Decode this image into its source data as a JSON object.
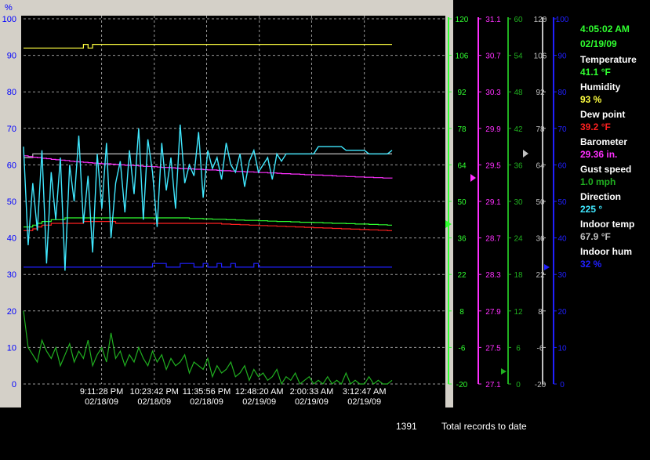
{
  "colors": {
    "background": "#000000",
    "plot_frame": "#d4d0c8",
    "grid": "#9a9a9a",
    "humidity": "#ffff40",
    "wind": "#40e8ff",
    "barometer": "#ff30ff",
    "temperature": "#30ff30",
    "dewpoint": "#ff2020",
    "indoor_hum": "#2020ff",
    "gust": "#20b020",
    "indoor_temp": "#c0c0c0"
  },
  "readouts": {
    "time": "4:05:02 AM",
    "date": "02/19/09",
    "items": [
      {
        "label": "Temperature",
        "value": "41.1 °F",
        "color": "#30ff30"
      },
      {
        "label": "Humidity",
        "value": "93 %",
        "color": "#ffff40"
      },
      {
        "label": "Dew point",
        "value": "39.2 °F",
        "color": "#ff2020"
      },
      {
        "label": "Barometer",
        "value": "29.36 in.",
        "color": "#ff30ff"
      },
      {
        "label": "Gust speed",
        "value": "1.0 mph",
        "color": "#20b020"
      },
      {
        "label": "Direction",
        "value": "225 °",
        "color": "#40e8ff"
      },
      {
        "label": "Indoor temp",
        "value": "67.9 °F",
        "color": "#c0c0c0"
      },
      {
        "label": "Indoor hum",
        "value": "32 %",
        "color": "#2020ff"
      }
    ]
  },
  "status": {
    "record_count": "1391",
    "record_text": "Total records to date"
  },
  "chart_data": {
    "type": "line",
    "left_axis": {
      "title": "%",
      "ticks": [
        "0",
        "10",
        "20",
        "30",
        "40",
        "50",
        "60",
        "70",
        "80",
        "90",
        "100"
      ],
      "range": [
        0,
        100
      ]
    },
    "x_ticks": [
      {
        "time": "9:11:28 PM",
        "date": "02/18/09",
        "pos": 0.148
      },
      {
        "time": "10:23:42 PM",
        "date": "02/18/09",
        "pos": 0.291
      },
      {
        "time": "11:35:56 PM",
        "date": "02/18/09",
        "pos": 0.433
      },
      {
        "time": "12:48:20 AM",
        "date": "02/19/09",
        "pos": 0.576
      },
      {
        "time": "2:00:33 AM",
        "date": "02/19/09",
        "pos": 0.718
      },
      {
        "time": "3:12:47 AM",
        "date": "02/19/09",
        "pos": 0.861
      }
    ],
    "right_axes": [
      {
        "name": "temperature",
        "ticks": [
          "-20",
          "-6",
          "8",
          "22",
          "36",
          "50",
          "64",
          "78",
          "92",
          "106",
          "120"
        ],
        "color": "#30ff30",
        "range": [
          -20,
          120
        ]
      },
      {
        "name": "barometer",
        "ticks": [
          "27.1",
          "27.5",
          "27.9",
          "28.3",
          "28.7",
          "29.1",
          "29.5",
          "29.9",
          "30.3",
          "30.7",
          "31.1"
        ],
        "color": "#ff30ff",
        "range": [
          27.1,
          31.1
        ]
      },
      {
        "name": "wind speed",
        "ticks": [
          "0",
          "6",
          "12",
          "18",
          "24",
          "30",
          "36",
          "42",
          "48",
          "54",
          "60"
        ],
        "color": "#20b020",
        "range": [
          0,
          60
        ]
      },
      {
        "name": "indoor temp",
        "ticks": [
          "-20",
          "-6",
          "8",
          "22",
          "36",
          "50",
          "64",
          "78",
          "92",
          "106",
          "120"
        ],
        "color": "#c0c0c0",
        "range": [
          -20,
          120
        ]
      },
      {
        "name": "indoor humidity",
        "ticks": [
          "0",
          "10",
          "20",
          "30",
          "40",
          "50",
          "60",
          "70",
          "80",
          "90",
          "100"
        ],
        "color": "#2020ff",
        "range": [
          0,
          100
        ]
      }
    ],
    "series": [
      {
        "key": "humidity",
        "color": "#ffff40",
        "values": [
          92,
          92,
          92,
          92,
          92,
          92,
          92,
          92,
          92,
          92,
          92,
          92,
          92,
          93,
          92,
          93,
          93,
          93,
          93,
          93,
          93,
          93,
          93,
          93,
          93,
          93,
          93,
          93,
          93,
          93,
          93,
          93,
          93,
          93,
          93,
          93,
          93,
          93,
          93,
          93,
          93,
          93,
          93,
          93,
          93,
          93,
          93,
          93,
          93,
          93,
          93,
          93,
          93,
          93,
          93,
          93,
          93,
          93,
          93,
          93,
          93,
          93,
          93,
          93,
          93,
          93,
          93,
          93,
          93,
          93,
          93,
          93,
          93,
          93,
          93,
          93,
          93,
          93,
          93,
          93,
          93
        ]
      },
      {
        "key": "indoor_temp",
        "color": "#c0c0c0",
        "values": [
          62,
          62,
          63,
          63,
          63,
          63,
          63,
          63,
          63,
          63,
          63,
          63,
          63,
          63,
          63,
          63,
          63,
          63,
          63,
          63,
          63,
          63,
          63,
          63,
          63,
          63,
          63,
          63,
          63,
          63,
          63,
          63,
          63,
          63,
          63,
          63,
          63,
          63,
          63,
          63,
          63,
          63,
          63,
          63,
          63,
          63,
          63,
          63,
          63,
          63,
          63,
          63,
          63,
          63,
          63,
          63,
          63,
          63,
          63,
          63,
          63,
          63,
          63,
          63,
          63,
          63,
          63,
          63,
          63,
          63,
          63,
          63,
          63,
          63,
          63,
          63,
          63,
          63,
          63,
          63,
          63
        ]
      },
      {
        "key": "barometer",
        "color": "#ff30ff",
        "values": [
          62.5,
          62.3,
          62.1,
          62.0,
          61.8,
          61.7,
          61.5,
          61.4,
          61.3,
          61.2,
          61.0,
          60.9,
          60.8,
          60.7,
          60.6,
          60.5,
          60.4,
          60.3,
          60.3,
          60.2,
          60.1,
          60.0,
          59.9,
          59.9,
          59.8,
          59.7,
          59.6,
          59.6,
          59.5,
          59.4,
          59.3,
          59.3,
          59.2,
          59.1,
          59.0,
          59.0,
          58.9,
          58.8,
          58.8,
          58.7,
          58.6,
          58.6,
          58.5,
          58.4,
          58.4,
          58.3,
          58.2,
          58.2,
          58.1,
          58.1,
          58.0,
          57.9,
          57.9,
          57.8,
          57.8,
          57.7,
          57.6,
          57.6,
          57.5,
          57.5,
          57.4,
          57.3,
          57.3,
          57.2,
          57.2,
          57.1,
          57.1,
          57.0,
          56.9,
          56.9,
          56.8,
          56.8,
          56.7,
          56.7,
          56.6,
          56.6,
          56.5,
          56.5,
          56.4,
          56.4,
          56.3
        ]
      },
      {
        "key": "temperature",
        "color": "#30ff30",
        "values": [
          43,
          43,
          43.5,
          44,
          44.5,
          44.5,
          45,
          45,
          45,
          45.5,
          45.5,
          45.5,
          45.5,
          45.5,
          45.5,
          45.5,
          45.5,
          45.5,
          45.5,
          45.5,
          45.5,
          45.5,
          45.5,
          45.5,
          45.5,
          45.5,
          45.5,
          45.5,
          45.5,
          45.5,
          45.5,
          45.5,
          45.5,
          45.5,
          45.5,
          45.5,
          45.3,
          45.3,
          45.3,
          45.2,
          45.2,
          45.1,
          45.1,
          45.1,
          45,
          45,
          44.9,
          44.9,
          44.8,
          44.8,
          44.8,
          44.7,
          44.7,
          44.6,
          44.6,
          44.5,
          44.5,
          44.5,
          44.4,
          44.4,
          44.3,
          44.3,
          44.3,
          44.2,
          44.2,
          44.1,
          44.1,
          44,
          44,
          44,
          43.9,
          43.9,
          43.8,
          43.8,
          43.8,
          43.7,
          43.7,
          43.6,
          43.6,
          43.5,
          43.5
        ]
      },
      {
        "key": "dewpoint",
        "color": "#ff2020",
        "values": [
          42,
          42,
          42.5,
          43,
          43.5,
          43.5,
          44,
          44,
          44,
          44,
          44,
          44,
          44,
          44.5,
          44.5,
          44.5,
          44.5,
          44.5,
          44.5,
          44.5,
          44,
          44,
          44,
          44,
          44,
          44,
          44,
          44,
          44,
          44,
          44,
          44,
          44,
          44,
          44,
          44,
          44,
          44,
          44,
          44,
          44,
          44,
          44,
          43.8,
          43.8,
          43.7,
          43.7,
          43.6,
          43.6,
          43.5,
          43.5,
          43.4,
          43.4,
          43.3,
          43.3,
          43.2,
          43.2,
          43.1,
          43.1,
          43,
          43,
          42.9,
          42.9,
          42.8,
          42.8,
          42.7,
          42.7,
          42.6,
          42.6,
          42.5,
          42.5,
          42.4,
          42.4,
          42.3,
          42.3,
          42.2,
          42.2,
          42.1,
          42.1,
          42,
          42
        ]
      },
      {
        "key": "indoor_hum",
        "color": "#2020ff",
        "values": [
          32,
          32,
          32,
          32,
          32,
          32,
          32,
          32,
          32,
          32,
          32,
          32,
          32,
          32,
          32,
          32,
          32,
          32,
          32,
          32,
          32,
          32,
          32,
          32,
          32,
          32,
          32,
          32,
          33,
          33,
          33,
          32,
          32,
          32,
          33,
          33,
          33,
          32,
          32,
          33,
          32,
          32,
          33,
          32,
          32,
          33,
          32,
          32,
          32,
          32,
          33,
          32,
          32,
          32,
          32,
          32,
          32,
          32,
          32,
          32,
          32,
          32,
          32,
          32,
          32,
          32,
          32,
          32,
          32,
          32,
          32,
          32,
          32,
          32,
          32,
          32,
          32,
          32,
          32,
          32,
          32
        ]
      },
      {
        "key": "wind_dir",
        "color": "#40e8ff",
        "values": [
          65,
          38,
          55,
          42,
          64,
          33,
          58,
          45,
          62,
          31,
          60,
          50,
          68,
          44,
          57,
          36,
          63,
          48,
          66,
          40,
          55,
          61,
          47,
          64,
          52,
          70,
          45,
          67,
          58,
          43,
          66,
          53,
          62,
          48,
          71,
          55,
          60,
          57,
          69,
          51,
          64,
          59,
          62,
          56,
          66,
          60,
          58,
          63,
          54,
          61,
          64,
          58,
          60,
          62,
          56,
          63,
          61,
          63,
          63,
          63,
          63,
          63,
          63,
          63,
          65,
          65,
          65,
          65,
          65,
          65,
          64,
          64,
          64,
          64,
          64,
          63,
          63,
          63,
          63,
          63,
          64
        ]
      },
      {
        "key": "gust",
        "color": "#20b020",
        "values": [
          20,
          10,
          8,
          6,
          12,
          9,
          7,
          10,
          5,
          8,
          11,
          6,
          9,
          7,
          12,
          5,
          8,
          10,
          6,
          14,
          7,
          9,
          5,
          8,
          6,
          10,
          7,
          5,
          9,
          6,
          8,
          4,
          7,
          5,
          6,
          8,
          3,
          6,
          5,
          4,
          7,
          2,
          5,
          3,
          4,
          6,
          2,
          3,
          5,
          1,
          4,
          2,
          3,
          1,
          2,
          4,
          0,
          2,
          1,
          3,
          0,
          1,
          2,
          0,
          1,
          0,
          2,
          0,
          1,
          0,
          3,
          0,
          1,
          0,
          0,
          2,
          0,
          1,
          0,
          0,
          1
        ]
      }
    ]
  }
}
